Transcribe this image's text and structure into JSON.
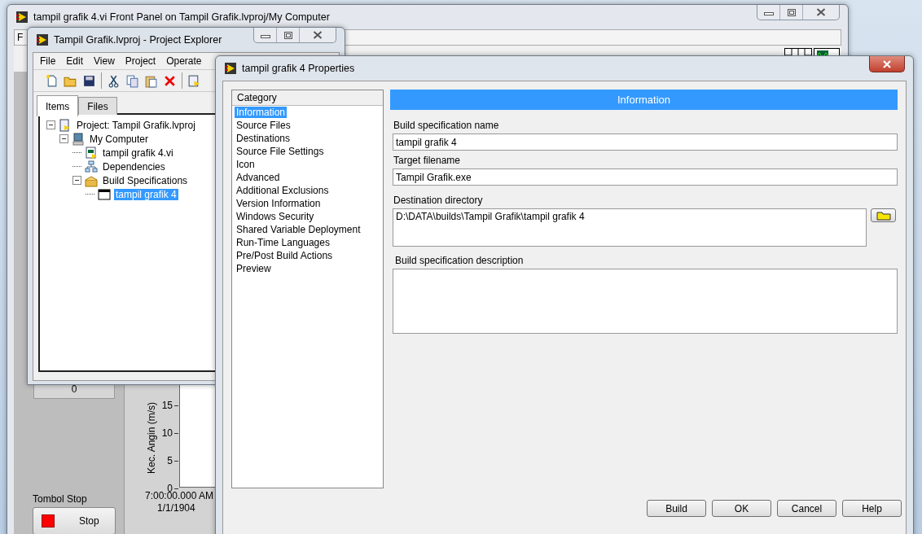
{
  "front_panel": {
    "title": "tampil grafik 4.vi Front Panel on Tampil Grafik.lvproj/My Computer",
    "menu": [
      "F"
    ],
    "numeric_value": "0",
    "chart": {
      "ylabel": "Kec. Angin (m/s)",
      "yticks": [
        "15",
        "10",
        "5",
        "0"
      ],
      "xtick_time": "7:00:00.000 AM",
      "xtick_date": "1/1/1904"
    },
    "stop_label": "Tombol Stop",
    "stop_button": "Stop"
  },
  "project_explorer": {
    "title": "Tampil Grafik.lvproj - Project Explorer",
    "menu": [
      "File",
      "Edit",
      "View",
      "Project",
      "Operate"
    ],
    "tabs": [
      {
        "label": "Items",
        "selected": true
      },
      {
        "label": "Files",
        "selected": false
      }
    ],
    "tree": [
      {
        "label": "Project: Tampil Grafik.lvproj",
        "kind": "project",
        "expanded": true,
        "selected": false,
        "children": [
          {
            "label": "My Computer",
            "kind": "computer",
            "expanded": true,
            "selected": false,
            "children": [
              {
                "label": "tampil grafik 4.vi",
                "kind": "vi",
                "selected": false
              },
              {
                "label": "Dependencies",
                "kind": "deps",
                "selected": false
              },
              {
                "label": "Build Specifications",
                "kind": "build",
                "expanded": true,
                "selected": false,
                "children": [
                  {
                    "label": "tampil grafik 4",
                    "kind": "app",
                    "selected": true
                  }
                ]
              }
            ]
          }
        ]
      }
    ]
  },
  "properties": {
    "title": "tampil grafik 4 Properties",
    "category_header": "Category",
    "categories": [
      {
        "label": "Information",
        "selected": true
      },
      {
        "label": "Source Files",
        "selected": false
      },
      {
        "label": "Destinations",
        "selected": false
      },
      {
        "label": "Source File Settings",
        "selected": false
      },
      {
        "label": "Icon",
        "selected": false
      },
      {
        "label": "Advanced",
        "selected": false
      },
      {
        "label": "Additional Exclusions",
        "selected": false
      },
      {
        "label": "Version Information",
        "selected": false
      },
      {
        "label": "Windows Security",
        "selected": false
      },
      {
        "label": "Shared Variable Deployment",
        "selected": false
      },
      {
        "label": "Run-Time Languages",
        "selected": false
      },
      {
        "label": "Pre/Post Build Actions",
        "selected": false
      },
      {
        "label": "Preview",
        "selected": false
      }
    ],
    "section_title": "Information",
    "fields": [
      {
        "label": "Build specification name",
        "value": "tampil grafik 4",
        "kind": "line"
      },
      {
        "label": "Target filename",
        "value": "Tampil Grafik.exe",
        "kind": "line"
      },
      {
        "label": "Destination directory",
        "value": "D:\\DATA\\builds\\Tampil Grafik\\tampil grafik 4",
        "kind": "path"
      },
      {
        "label": "Build specification description",
        "kind": "area"
      }
    ],
    "buttons": [
      "Build",
      "OK",
      "Cancel",
      "Help"
    ]
  }
}
